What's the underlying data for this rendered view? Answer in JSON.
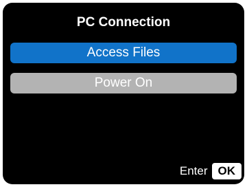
{
  "title": "PC Connection",
  "menu": {
    "items": [
      {
        "label": "Access Files",
        "selected": true
      },
      {
        "label": "Power On",
        "selected": false
      }
    ]
  },
  "footer": {
    "enter_label": "Enter",
    "ok_label": "OK"
  },
  "colors": {
    "background": "#000000",
    "selected": "#1173c9",
    "unselected": "#b3b3b3",
    "text": "#ffffff"
  }
}
